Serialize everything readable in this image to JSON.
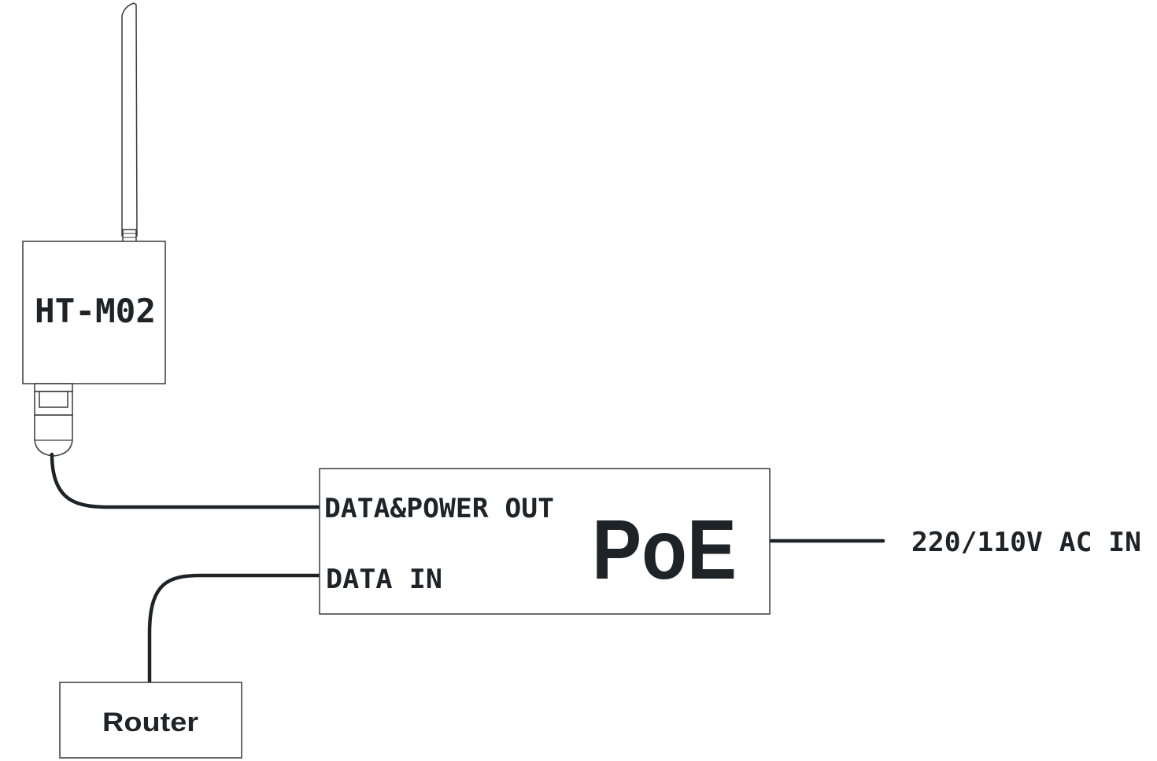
{
  "device": {
    "model_label": "HT-M02"
  },
  "poe": {
    "title": "PoE",
    "port_out_label": "DATA&POWER OUT",
    "port_in_label": "DATA IN"
  },
  "power": {
    "input_label": "220/110V AC IN"
  },
  "router": {
    "label": "Router"
  },
  "colors": {
    "line": "#1e2328",
    "outline": "#3a3a3a",
    "background": "#ffffff"
  }
}
